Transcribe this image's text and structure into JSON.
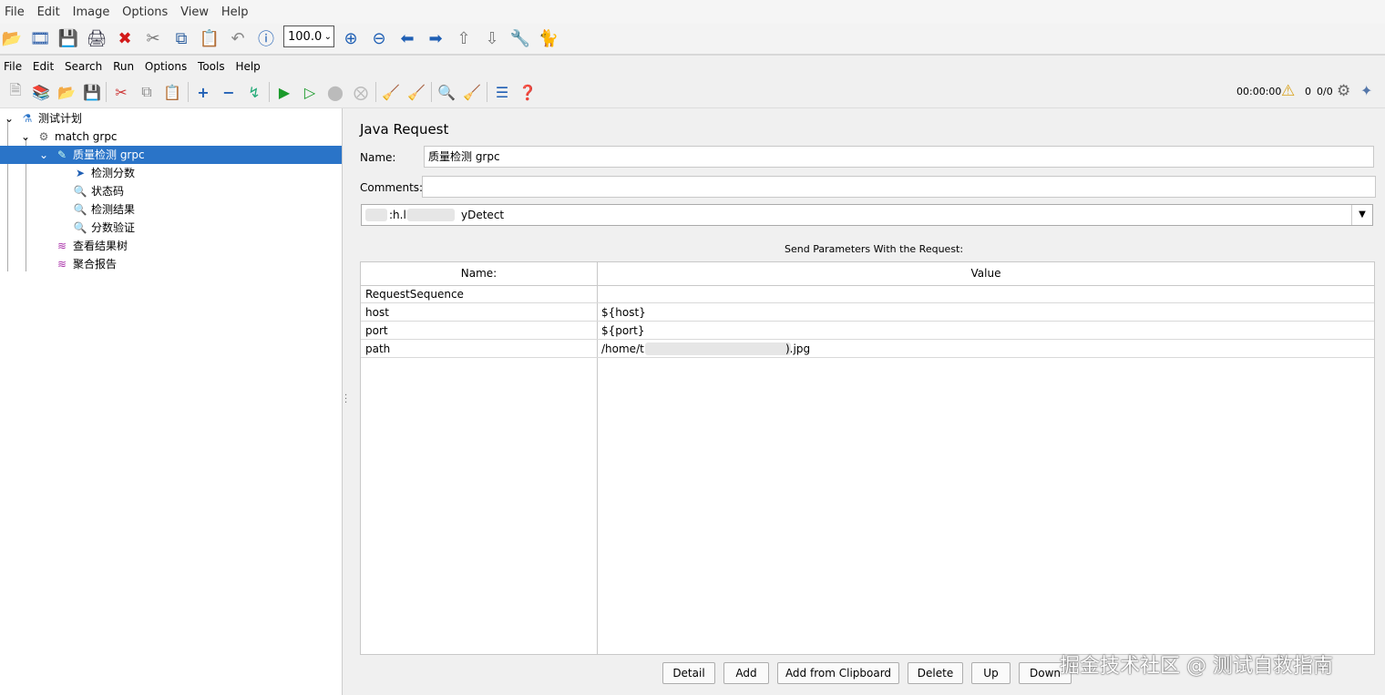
{
  "viewer": {
    "menu": [
      "File",
      "Edit",
      "Image",
      "Options",
      "View",
      "Help"
    ],
    "zoom_value": "100.0"
  },
  "app": {
    "menu": [
      "File",
      "Edit",
      "Search",
      "Run",
      "Options",
      "Tools",
      "Help"
    ],
    "elapsed": "00:00:00",
    "warnings": "0",
    "threads": "0/0"
  },
  "tree": {
    "nodes": [
      {
        "label": "测试计划",
        "icon": "flask-icon"
      },
      {
        "label": "match grpc",
        "icon": "gear-icon"
      },
      {
        "label": "质量检测 grpc",
        "icon": "sampler-icon"
      },
      {
        "label": "检测分数",
        "icon": "preprocessor-icon"
      },
      {
        "label": "状态码",
        "icon": "assertion-icon"
      },
      {
        "label": "检测结果",
        "icon": "assertion-icon"
      },
      {
        "label": "分数验证",
        "icon": "assertion-icon"
      },
      {
        "label": "查看结果树",
        "icon": "listener-icon"
      },
      {
        "label": "聚合报告",
        "icon": "listener-icon"
      }
    ]
  },
  "panel": {
    "title": "Java Request",
    "name_label": "Name:",
    "name_value": "质量检测 grpc",
    "comments_label": "Comments:",
    "comments_value": "",
    "class_prefix": ":h.l",
    "class_suffix": "yDetect",
    "params_title": "Send Parameters With the Request:",
    "col_name": "Name:",
    "col_value": "Value",
    "rows": [
      {
        "name": "RequestSequence",
        "value": ""
      },
      {
        "name": "host",
        "value": "${host}"
      },
      {
        "name": "port",
        "value": "${port}"
      },
      {
        "name": "path",
        "value_prefix": "/home/t",
        "value_suffix": ").jpg"
      }
    ],
    "buttons": [
      "Detail",
      "Add",
      "Add from Clipboard",
      "Delete",
      "Up",
      "Down"
    ]
  },
  "watermark": "掘金技术社区 @ 测试自救指南"
}
